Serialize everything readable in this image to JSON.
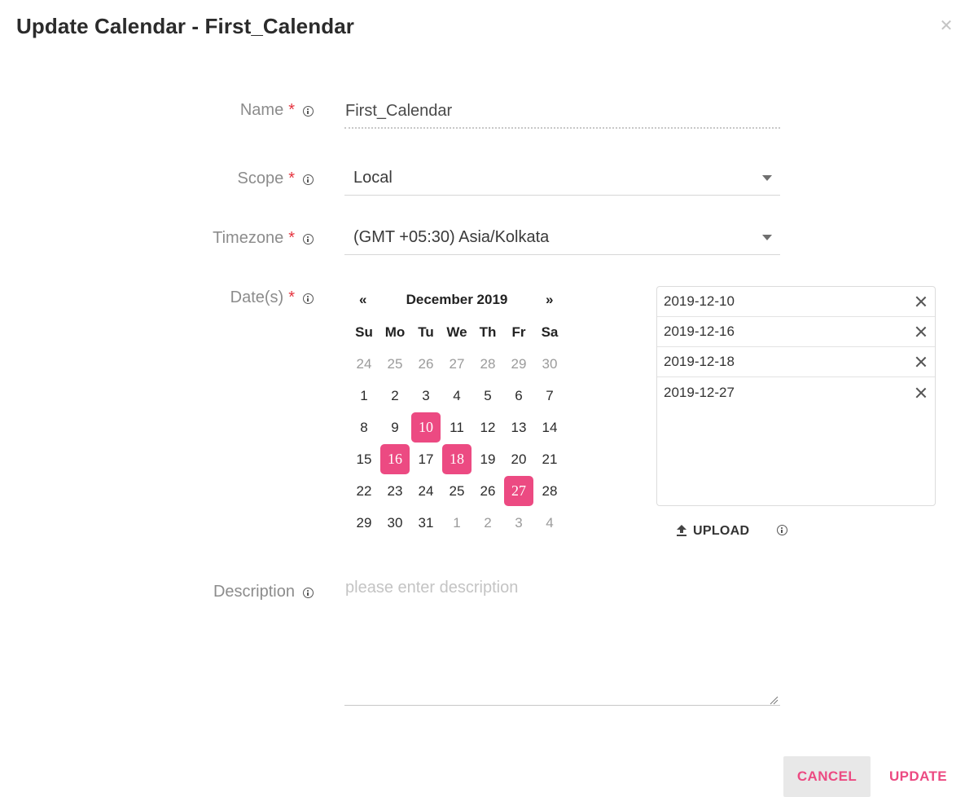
{
  "dialog": {
    "title": "Update Calendar - First_Calendar",
    "close_icon": "close-icon"
  },
  "form": {
    "name": {
      "label": "Name",
      "required_mark": "*",
      "value": "First_Calendar"
    },
    "scope": {
      "label": "Scope",
      "required_mark": "*",
      "value": "Local"
    },
    "timezone": {
      "label": "Timezone",
      "required_mark": "*",
      "value": "(GMT +05:30) Asia/Kolkata"
    },
    "dates": {
      "label": "Date(s)",
      "required_mark": "*"
    },
    "description": {
      "label": "Description",
      "placeholder": "please enter description",
      "value": ""
    }
  },
  "calendar": {
    "prev": "«",
    "next": "»",
    "month_label": "December 2019",
    "weekdays": [
      "Su",
      "Mo",
      "Tu",
      "We",
      "Th",
      "Fr",
      "Sa"
    ],
    "weeks": [
      [
        {
          "d": "24",
          "muted": true
        },
        {
          "d": "25",
          "muted": true
        },
        {
          "d": "26",
          "muted": true
        },
        {
          "d": "27",
          "muted": true
        },
        {
          "d": "28",
          "muted": true
        },
        {
          "d": "29",
          "muted": true
        },
        {
          "d": "30",
          "muted": true
        }
      ],
      [
        {
          "d": "1"
        },
        {
          "d": "2"
        },
        {
          "d": "3"
        },
        {
          "d": "4"
        },
        {
          "d": "5"
        },
        {
          "d": "6"
        },
        {
          "d": "7"
        }
      ],
      [
        {
          "d": "8"
        },
        {
          "d": "9"
        },
        {
          "d": "10",
          "selected": true
        },
        {
          "d": "11"
        },
        {
          "d": "12"
        },
        {
          "d": "13"
        },
        {
          "d": "14"
        }
      ],
      [
        {
          "d": "15"
        },
        {
          "d": "16",
          "selected": true
        },
        {
          "d": "17"
        },
        {
          "d": "18",
          "selected": true
        },
        {
          "d": "19"
        },
        {
          "d": "20"
        },
        {
          "d": "21"
        }
      ],
      [
        {
          "d": "22"
        },
        {
          "d": "23"
        },
        {
          "d": "24"
        },
        {
          "d": "25"
        },
        {
          "d": "26"
        },
        {
          "d": "27",
          "selected": true
        },
        {
          "d": "28"
        }
      ],
      [
        {
          "d": "29"
        },
        {
          "d": "30"
        },
        {
          "d": "31"
        },
        {
          "d": "1",
          "muted": true
        },
        {
          "d": "2",
          "muted": true
        },
        {
          "d": "3",
          "muted": true
        },
        {
          "d": "4",
          "muted": true
        }
      ]
    ],
    "selected_color": "#ec4a82"
  },
  "selected_dates": [
    "2019-12-10",
    "2019-12-16",
    "2019-12-18",
    "2019-12-27"
  ],
  "upload": {
    "label": "UPLOAD",
    "icon": "upload-icon"
  },
  "footer": {
    "cancel_label": "CANCEL",
    "update_label": "UPDATE"
  },
  "colors": {
    "accent": "#ec4a82",
    "required": "#e5333e"
  }
}
